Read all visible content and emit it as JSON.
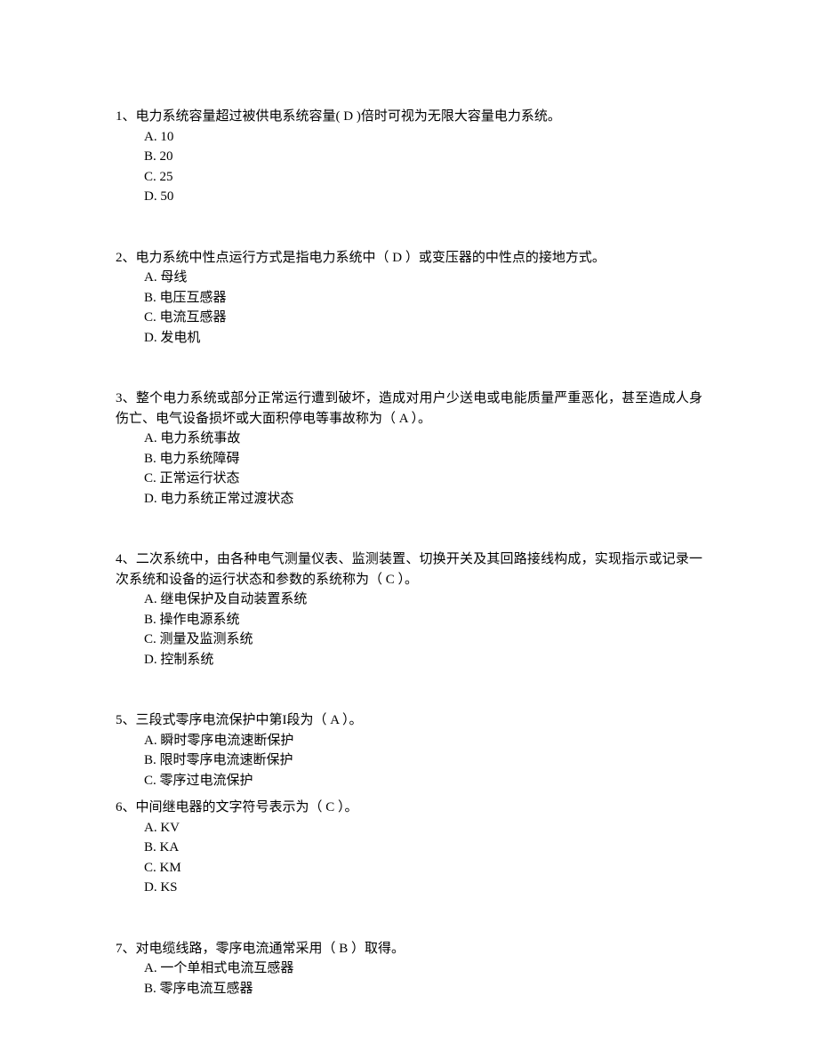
{
  "questions": [
    {
      "number": "1",
      "text_before": "、电力系统容量超过被供电系统容量(",
      "answer": "  D ",
      "text_after": ")倍时可视为无限大容量电力系统。",
      "options": [
        {
          "label": "A.",
          "text": "10"
        },
        {
          "label": "B.",
          "text": "20"
        },
        {
          "label": "C.",
          "text": "25"
        },
        {
          "label": "D.",
          "text": "50"
        }
      ]
    },
    {
      "number": "2",
      "text_before": "、电力系统中性点运行方式是指电力系统中（",
      "answer": " D  ",
      "text_after": "）或变压器的中性点的接地方式。",
      "options": [
        {
          "label": "A.",
          "text": "母线"
        },
        {
          "label": "B.",
          "text": "电压互感器"
        },
        {
          "label": "C.",
          "text": "电流互感器"
        },
        {
          "label": "D.",
          "text": "发电机"
        }
      ]
    },
    {
      "number": "3",
      "text_before": "、整个电力系统或部分正常运行遭到破坏，造成对用户少送电或电能质量严重恶化，甚至造成人身伤亡、电气设备损坏或大面积停电等事故称为（",
      "answer": "  A ",
      "text_after": "）。",
      "options": [
        {
          "label": "A.",
          "text": "电力系统事故"
        },
        {
          "label": "B.",
          "text": "电力系统障碍"
        },
        {
          "label": "C.",
          "text": "正常运行状态"
        },
        {
          "label": "D.",
          "text": "电力系统正常过渡状态"
        }
      ]
    },
    {
      "number": "4",
      "text_before": "、二次系统中，由各种电气测量仪表、监测装置、切换开关及其回路接线构成，实现指示或记录一次系统和设备的运行状态和参数的系统称为（",
      "answer": "  C ",
      "text_after": "）。",
      "options": [
        {
          "label": "A.",
          "text": "继电保护及自动装置系统"
        },
        {
          "label": "B.",
          "text": "操作电源系统"
        },
        {
          "label": "C.",
          "text": "测量及监测系统"
        },
        {
          "label": "D.",
          "text": "控制系统"
        }
      ]
    },
    {
      "number": "5",
      "text_before": "、三段式零序电流保护中第I段为（",
      "answer": " A  ",
      "text_after": "）。",
      "options": [
        {
          "label": "A.",
          "text": "瞬时零序电流速断保护"
        },
        {
          "label": "B.",
          "text": "限时零序电流速断保护"
        },
        {
          "label": "C.",
          "text": "零序过电流保护"
        }
      ]
    },
    {
      "number": "6",
      "text_before": "、中间继电器的文字符号表示为（",
      "answer": " C  ",
      "text_after": "）。",
      "options": [
        {
          "label": "A.",
          "text": "KV"
        },
        {
          "label": "B.",
          "text": "KA"
        },
        {
          "label": "C.",
          "text": "KM"
        },
        {
          "label": "D.",
          "text": "KS"
        }
      ]
    },
    {
      "number": "7",
      "text_before": "、对电缆线路，零序电流通常采用（",
      "answer": " B  ",
      "text_after": "）取得。",
      "options": [
        {
          "label": "A.",
          "text": "一个单相式电流互感器"
        },
        {
          "label": "B.",
          "text": "零序电流互感器"
        }
      ]
    }
  ]
}
